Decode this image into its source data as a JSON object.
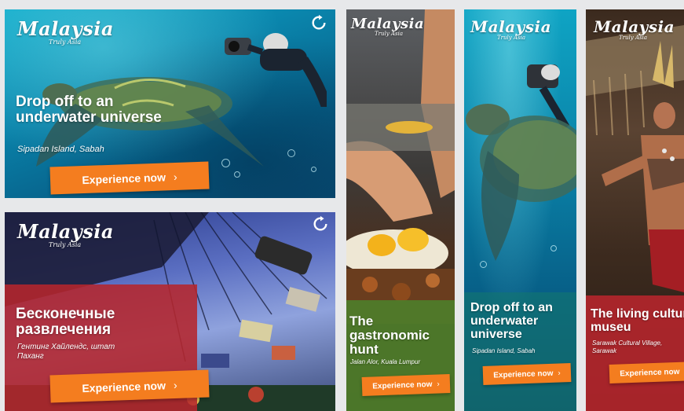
{
  "brand": {
    "logo_text": "Malaysia",
    "tagline": "Truly Asia"
  },
  "colors": {
    "cta": "#f47d1f",
    "ocean": "#0a7fa4",
    "red_panel": "#b5262c",
    "green_panel": "#4e7d2a"
  },
  "banners": [
    {
      "id": "underwater-wide",
      "headline": "Drop off to an underwater universe",
      "location": "Sipadan Island, Sabah",
      "cta": "Experience now",
      "icon": "replay-icon"
    },
    {
      "id": "amusement-wide",
      "headline": "Бесконечные развлечения",
      "location": "Гентинг Хайлендс, штат Паханг",
      "cta": "Experience now",
      "icon": "replay-icon"
    },
    {
      "id": "food-tall",
      "headline": "The gastronomic hunt",
      "location": "Jalan Alor, Kuala Lumpur",
      "cta": "Experience now"
    },
    {
      "id": "underwater-tall",
      "headline": "Drop off to an underwater universe",
      "location": "Sipadan Island, Sabah",
      "cta": "Experience now"
    },
    {
      "id": "culture-tall",
      "headline": "The living cultural museu",
      "location": "Sarawak Cultural Village, Sarawak",
      "cta": "Experience now"
    }
  ]
}
